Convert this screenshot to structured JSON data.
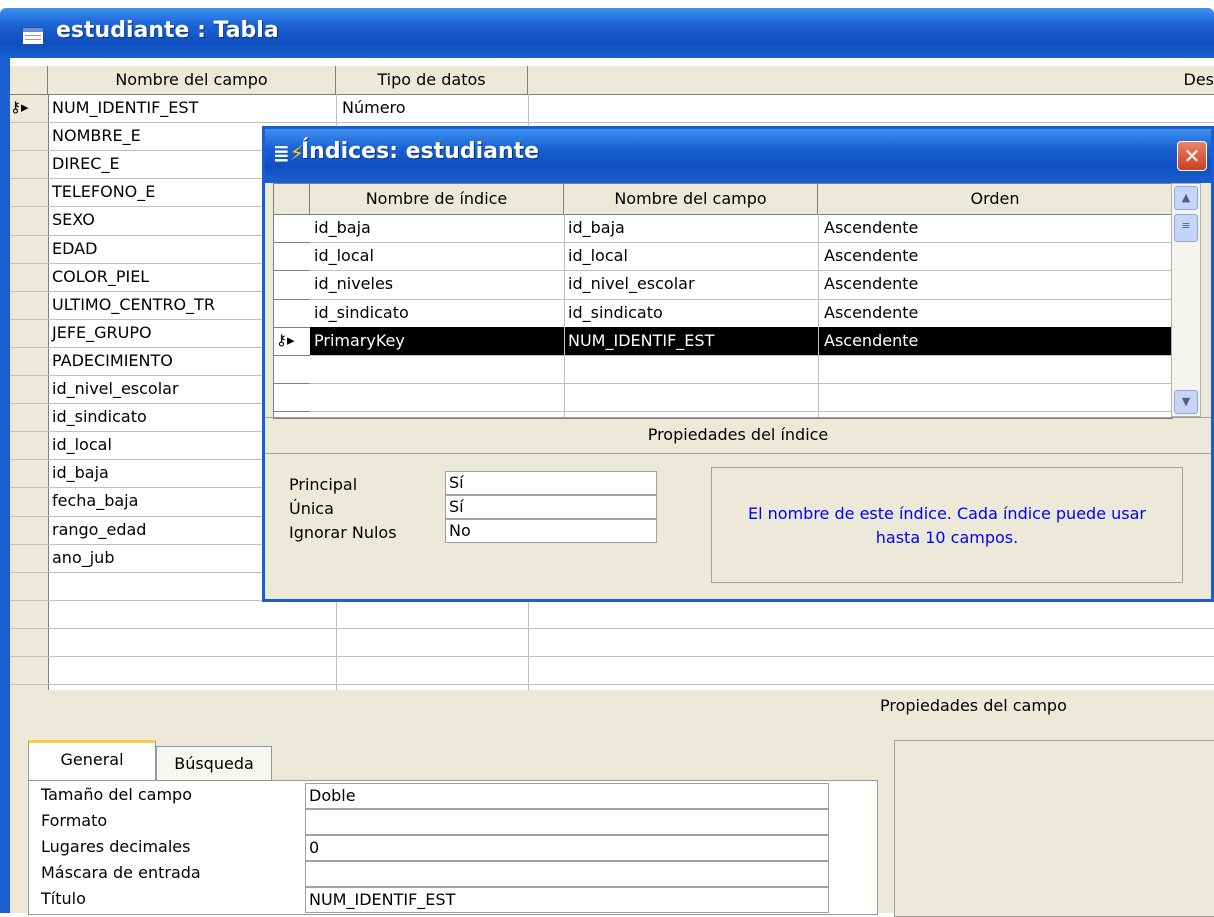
{
  "window": {
    "title": "estudiante : Tabla"
  },
  "table_grid": {
    "headers": [
      "Nombre del campo",
      "Tipo de datos",
      "Des"
    ],
    "rows": [
      {
        "name": "NUM_IDENTIF_EST",
        "type": "Número",
        "key": true
      },
      {
        "name": "NOMBRE_E",
        "type": ""
      },
      {
        "name": "DIREC_E",
        "type": ""
      },
      {
        "name": "TELEFONO_E",
        "type": ""
      },
      {
        "name": "SEXO",
        "type": ""
      },
      {
        "name": "EDAD",
        "type": ""
      },
      {
        "name": "COLOR_PIEL",
        "type": ""
      },
      {
        "name": "ULTIMO_CENTRO_TR",
        "type": ""
      },
      {
        "name": "JEFE_GRUPO",
        "type": ""
      },
      {
        "name": "PADECIMIENTO",
        "type": ""
      },
      {
        "name": "id_nivel_escolar",
        "type": ""
      },
      {
        "name": "id_sindicato",
        "type": ""
      },
      {
        "name": "id_local",
        "type": ""
      },
      {
        "name": "id_baja",
        "type": ""
      },
      {
        "name": "fecha_baja",
        "type": ""
      },
      {
        "name": "rango_edad",
        "type": ""
      },
      {
        "name": "ano_jub",
        "type": ""
      }
    ]
  },
  "field_properties": {
    "header": "Propiedades del campo",
    "tabs": [
      "General",
      "Búsqueda"
    ],
    "props": [
      {
        "label": "Tamaño del campo",
        "value": "Doble"
      },
      {
        "label": "Formato",
        "value": ""
      },
      {
        "label": "Lugares decimales",
        "value": "0"
      },
      {
        "label": "Máscara de entrada",
        "value": ""
      },
      {
        "label": "Título",
        "value": "NUM_IDENTIF_EST"
      }
    ]
  },
  "indexes_dialog": {
    "title": "Índices: estudiante",
    "close": "✕",
    "headers": [
      "Nombre de índice",
      "Nombre del campo",
      "Orden"
    ],
    "rows": [
      {
        "index": "id_baja",
        "field": "id_baja",
        "order": "Ascendente"
      },
      {
        "index": "id_local",
        "field": "id_local",
        "order": "Ascendente"
      },
      {
        "index": "id_niveles",
        "field": "id_nivel_escolar",
        "order": "Ascendente"
      },
      {
        "index": "id_sindicato",
        "field": "id_sindicato",
        "order": "Ascendente"
      },
      {
        "index": "PrimaryKey",
        "field": "NUM_IDENTIF_EST",
        "order": "Ascendente",
        "selected": true
      }
    ],
    "props_header": "Propiedades del índice",
    "props": [
      {
        "label": "Principal",
        "value": "Sí"
      },
      {
        "label": "Única",
        "value": "Sí"
      },
      {
        "label": "Ignorar Nulos",
        "value": "No"
      }
    ],
    "help_text": "El nombre de este índice. Cada índice puede usar hasta 10 campos."
  },
  "colors": {
    "title_blue": "#1a5fd2",
    "help_blue": "#0000ff",
    "tab_highlight": "#ffc83c"
  },
  "icons": [
    "table-icon",
    "key-icon",
    "row-pointer-icon",
    "indexes-icon",
    "close-icon",
    "scroll-up-icon",
    "scroll-down-icon"
  ]
}
